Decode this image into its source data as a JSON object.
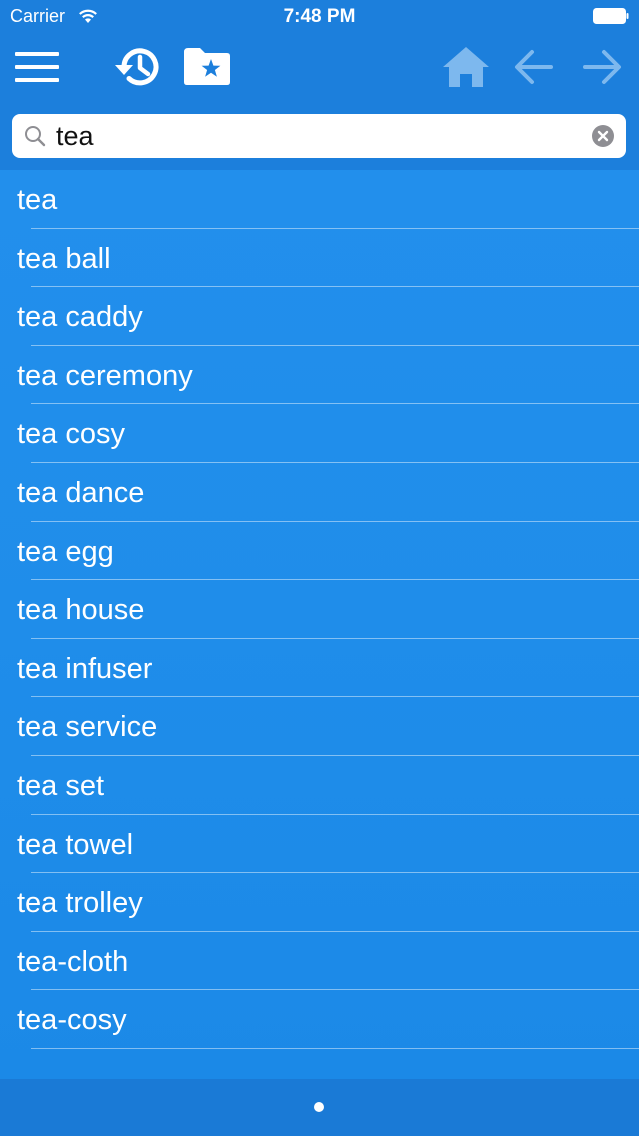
{
  "status": {
    "carrier": "Carrier",
    "time": "7:48 PM"
  },
  "toolbar": {
    "icons": [
      "menu-icon",
      "history-icon",
      "favorites-folder-icon",
      "home-icon",
      "back-arrow-icon",
      "forward-arrow-icon"
    ]
  },
  "search": {
    "value": "tea",
    "placeholder": ""
  },
  "results": [
    "tea",
    "tea ball",
    "tea caddy",
    "tea ceremony",
    "tea cosy",
    "tea dance",
    "tea egg",
    "tea house",
    "tea infuser",
    "tea service",
    "tea set",
    "tea towel",
    "tea trolley",
    "tea-cloth",
    "tea-cosy"
  ],
  "colors": {
    "accent": "#1c7fdc",
    "list_bg": "#1e8ae6",
    "inactive_icon": "#7db8ee"
  },
  "pager": {
    "current_page": 1
  }
}
